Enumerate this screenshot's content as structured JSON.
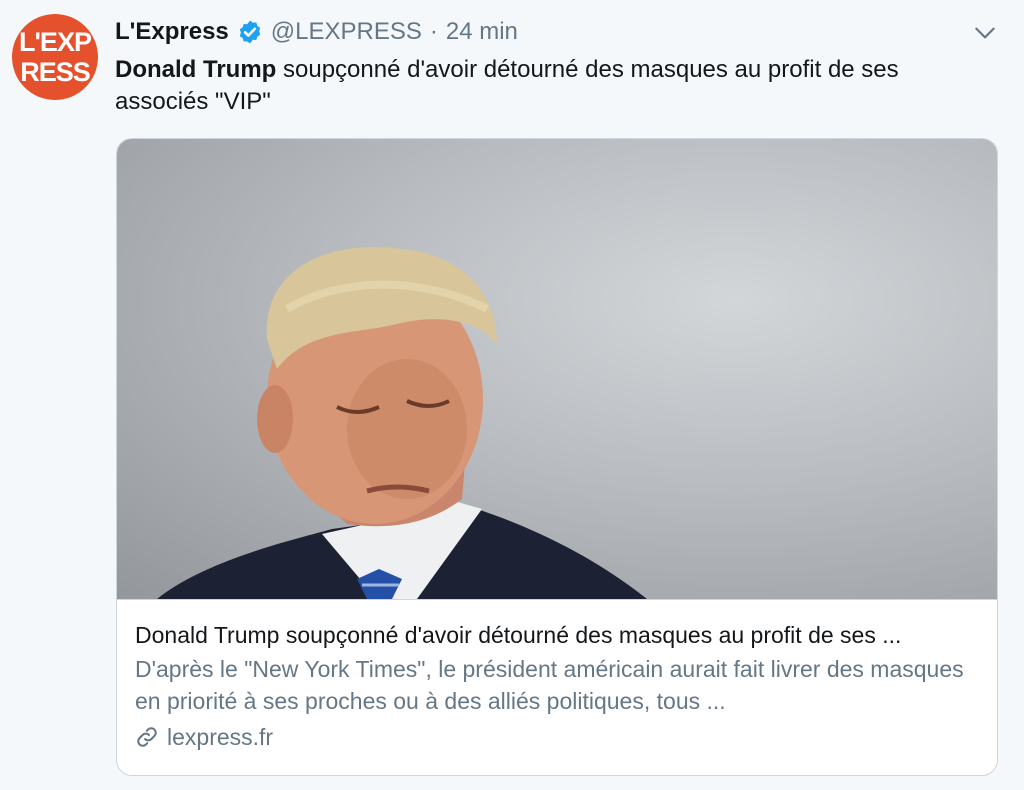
{
  "account": {
    "avatar_line1": "L'EXP",
    "avatar_line2": "RESS",
    "name": "L'Express",
    "handle": "@LEXPRESS",
    "separator": "·",
    "time": "24 min"
  },
  "tweet": {
    "bold": "Donald Trump",
    "rest": " soupçonné d'avoir détourné des masques au profit de ses associés \"VIP\""
  },
  "card": {
    "title": "Donald Trump soupçonné d'avoir détourné des masques au profit de ses ...",
    "description": "D'après le \"New York Times\", le président américain aurait fait livrer des masques en priorité à ses proches ou à des alliés politiques, tous ...",
    "domain": "lexpress.fr"
  },
  "icons": {
    "verified": "verified-badge-icon",
    "chevron": "chevron-down-icon",
    "link": "link-icon"
  },
  "colors": {
    "avatar_bg": "#e4512c",
    "verified": "#1da1f2",
    "secondary_text": "#657786",
    "background": "#f5f8fa"
  }
}
